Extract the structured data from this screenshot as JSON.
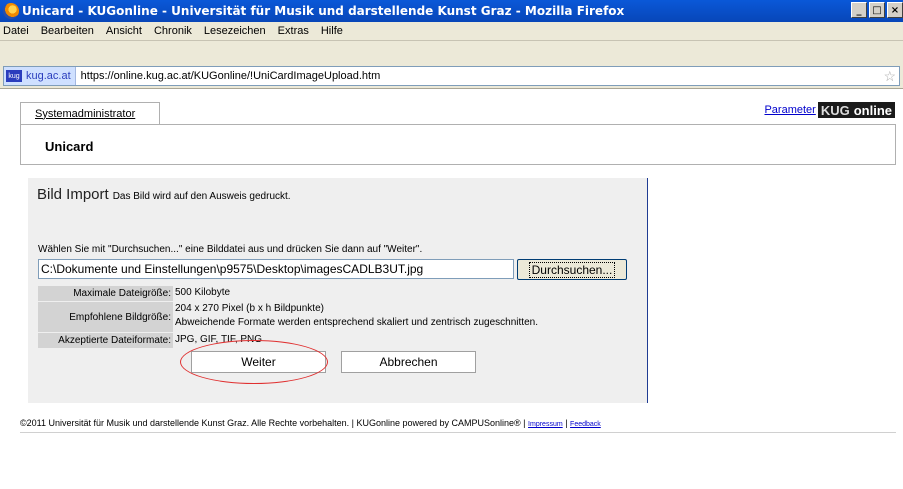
{
  "window": {
    "title": "Unicard - KUGonline - Universität für Musik und darstellende Kunst Graz - Mozilla Firefox",
    "buttons": [
      "_",
      "□",
      "×"
    ]
  },
  "menu": [
    "Datei",
    "Bearbeiten",
    "Ansicht",
    "Chronik",
    "Lesezeichen",
    "Extras",
    "Hilfe"
  ],
  "urlbar": {
    "site": "kug.ac.at",
    "url": "https://online.kug.ac.at/KUGonline/!UniCardImageUpload.htm",
    "site_icon_text": "kug"
  },
  "page": {
    "tab_label": "Systemadministrator",
    "param_link": "Parameter",
    "logo_kug": "KUG",
    "logo_online": "online",
    "header_title": "Unicard"
  },
  "import": {
    "title": "Bild Import",
    "subtitle": "Das Bild wird auf den Ausweis gedruckt.",
    "hint": "Wählen Sie mit \"Durchsuchen...\" eine Bilddatei aus und drücken Sie dann auf \"Weiter\".",
    "file_path": "C:\\Dokumente und Einstellungen\\p9575\\Desktop\\imagesCADLB3UT.jpg",
    "browse_label": "Durchsuchen...",
    "rows": [
      {
        "label": "Maximale Dateigröße:",
        "value": "500 Kilobyte"
      },
      {
        "label": "Empfohlene Bildgröße:",
        "value": "204 x 270 Pixel (b x h Bildpunkte)",
        "value2": "Abweichende Formate werden entsprechend skaliert und zentrisch zugeschnitten."
      },
      {
        "label": "Akzeptierte Dateiformate:",
        "value": "JPG, GIF, TIF, PNG"
      }
    ],
    "next_label": "Weiter",
    "cancel_label": "Abbrechen"
  },
  "footer": {
    "text": "©2011 Universität für Musik und darstellende Kunst Graz. Alle Rechte vorbehalten. | KUGonline powered by CAMPUSonline® |",
    "impressum": "Impressum",
    "sep": "|",
    "feedback": "Feedback"
  }
}
